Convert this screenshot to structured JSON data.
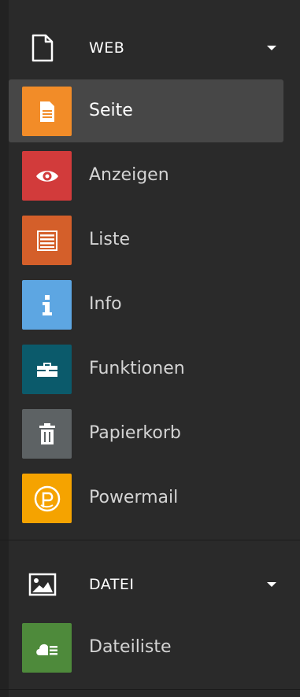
{
  "groups": [
    {
      "label": "WEB",
      "icon": "file-icon",
      "items": [
        {
          "label": "Seite",
          "icon": "page-icon",
          "color": "#f28c28"
        },
        {
          "label": "Anzeigen",
          "icon": "eye-icon",
          "color": "#d23b3b"
        },
        {
          "label": "Liste",
          "icon": "list-icon",
          "color": "#d45f2a"
        },
        {
          "label": "Info",
          "icon": "info-icon",
          "color": "#5da6e2"
        },
        {
          "label": "Funktionen",
          "icon": "toolbox-icon",
          "color": "#0b5a6b"
        },
        {
          "label": "Papierkorb",
          "icon": "trash-icon",
          "color": "#5d6264"
        },
        {
          "label": "Powermail",
          "icon": "powermail-icon",
          "color": "#f5a300"
        }
      ]
    },
    {
      "label": "DATEI",
      "icon": "image-icon",
      "items": [
        {
          "label": "Dateiliste",
          "icon": "cloud-list-icon",
          "color": "#4e8a3b"
        }
      ]
    }
  ],
  "active_item": "Seite",
  "colors": {
    "panel_bg": "#2a2a2a",
    "active_bg": "#474747",
    "text": "#d4d4d4",
    "text_active": "#ffffff"
  }
}
